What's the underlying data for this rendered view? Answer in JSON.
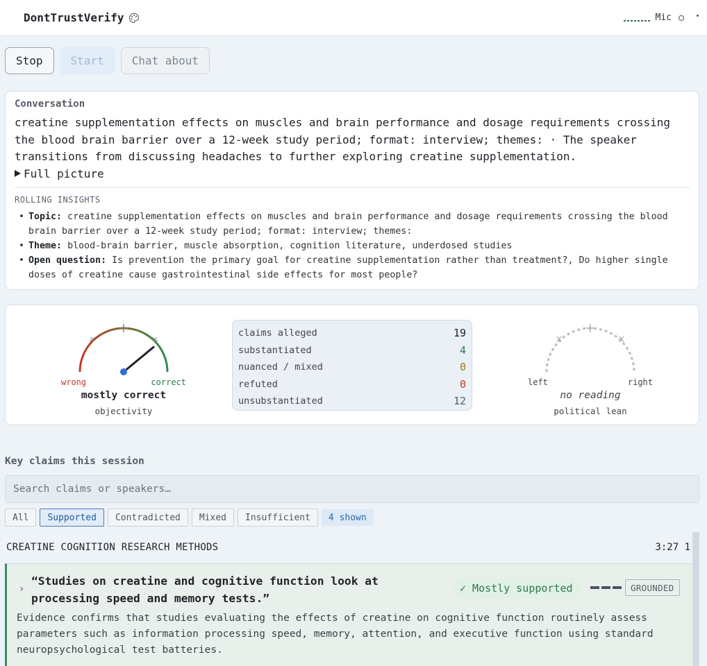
{
  "app": {
    "title": "DontTrustVerify",
    "theme_icon": "palette-icon",
    "mic_label": "Mic"
  },
  "controls": {
    "stop": "Stop",
    "start": "Start",
    "chat": "Chat about"
  },
  "conversation": {
    "heading": "Conversation",
    "summary": "creatine supplementation effects on muscles and brain performance and dosage requirements crossing the blood brain barrier over a 12-week study period; format: interview; themes: · The speaker transitions from discussing headaches to further exploring creatine supplementation.",
    "full_picture": "Full picture",
    "insights_heading": "ROLLING INSIGHTS",
    "insights": [
      {
        "label": "Topic:",
        "text": "creatine supplementation effects on muscles and brain performance and dosage requirements crossing the blood brain barrier over a 12-week study period; format: interview; themes:"
      },
      {
        "label": "Theme:",
        "text": "blood-brain barrier, muscle absorption, cognition literature, underdosed studies"
      },
      {
        "label": "Open question:",
        "text": "Is prevention the primary goal for creatine supplementation rather than treatment?, Do higher single doses of creatine cause gastrointestinal side effects for most people?"
      }
    ]
  },
  "objectivity": {
    "left": "wrong",
    "right": "correct",
    "reading": "mostly correct",
    "caption": "objectivity",
    "value": 0.78
  },
  "political": {
    "left": "left",
    "right": "right",
    "reading": "no reading",
    "caption": "political lean"
  },
  "stats": [
    {
      "label": "claims alleged",
      "value": "19",
      "color": "#1f2328"
    },
    {
      "label": "substantiated",
      "value": "4",
      "color": "#2d7a4a"
    },
    {
      "label": "nuanced / mixed",
      "value": "0",
      "color": "#a07a10"
    },
    {
      "label": "refuted",
      "value": "0",
      "color": "#c0392b"
    },
    {
      "label": "unsubstantiated",
      "value": "12",
      "color": "#555d66"
    }
  ],
  "claims_section": {
    "heading": "Key claims this session",
    "search_placeholder": "Search claims or speakers…",
    "filters": [
      "All",
      "Supported",
      "Contradicted",
      "Mixed",
      "Insufficient"
    ],
    "active_filter": "Supported",
    "shown": "4 shown"
  },
  "group": {
    "title": "CREATINE COGNITION RESEARCH METHODS",
    "time": "3:27 1"
  },
  "claim": {
    "quote": "“Studies on creatine and cognitive function look at processing speed and memory tests.”",
    "verdict": "✓ Mostly supported",
    "tag": "GROUNDED",
    "evidence": "Evidence confirms that studies evaluating the effects of creatine on cognitive function routinely assess parameters such as information processing speed, memory, attention, and executive function using standard neuropsychological test batteries."
  }
}
